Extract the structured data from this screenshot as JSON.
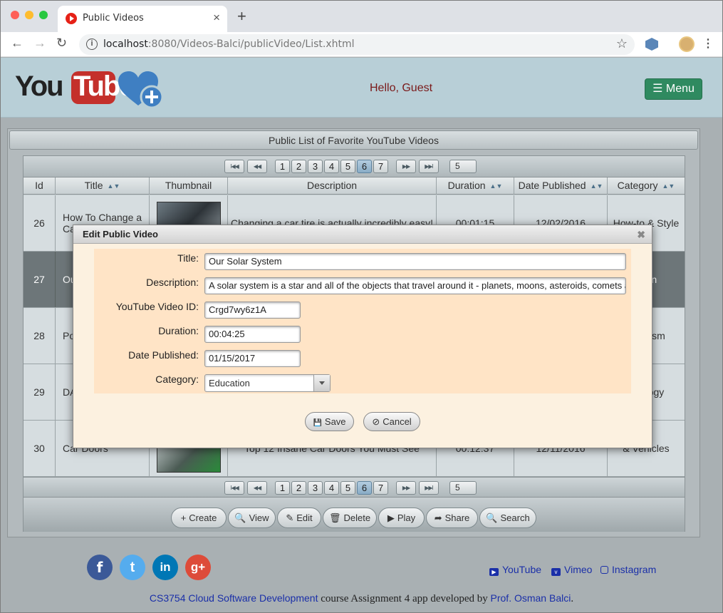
{
  "browser": {
    "tab_title": "Public Videos",
    "tab_close": "×",
    "new_tab": "+",
    "url_host": "localhost",
    "url_rest": ":8080/Videos-Balci/publicVideo/List.xhtml",
    "back": "←",
    "forward": "→",
    "reload": "↻",
    "bookmark": "☆",
    "kebab": "⋮"
  },
  "header": {
    "logo_you": "You",
    "logo_tube": "Tube",
    "greeting": "Hello, Guest",
    "menu_label": "☰ Menu"
  },
  "panel": {
    "title": "Public List of Favorite YouTube Videos",
    "pager": {
      "first": "I◀◀",
      "prev": "◀◀",
      "pages": [
        "1",
        "2",
        "3",
        "4",
        "5",
        "6",
        "7"
      ],
      "active_page": "6",
      "next": "▶▶",
      "last": "▶▶I",
      "rows_per_page": "5"
    },
    "columns": [
      "Id",
      "Title",
      "Thumbnail",
      "Description",
      "Duration",
      "Date Published",
      "Category"
    ],
    "sort_icon": "▲▼",
    "rows": [
      {
        "id": "26",
        "title": "How To Change a Ca",
        "description": "Changing a car tire is actually incredibly easy!",
        "duration": "00:01:15",
        "date": "12/02/2016",
        "category": "How-to & Style"
      },
      {
        "id": "27",
        "title": "Ou",
        "description": "",
        "duration": "",
        "date": "",
        "category": "ation"
      },
      {
        "id": "28",
        "title": "Po Ur Re",
        "description": "",
        "duration": "",
        "date": "",
        "category": "fits & sm"
      },
      {
        "id": "29",
        "title": "DA Te",
        "description": "",
        "duration": "",
        "date": "",
        "category": "e & logy"
      },
      {
        "id": "30",
        "title": "Car Doors",
        "description": "Top 12 Insane Car Doors You Must See",
        "duration": "00:12:37",
        "date": "12/11/2016",
        "category": "& Vehicles"
      }
    ],
    "actions": [
      {
        "icon": "+",
        "label": "Create"
      },
      {
        "icon": "🔍",
        "label": "View"
      },
      {
        "icon": "✎",
        "label": "Edit"
      },
      {
        "icon": "🗑",
        "label": "Delete"
      },
      {
        "icon": "▶",
        "label": "Play"
      },
      {
        "icon": "➦",
        "label": "Share"
      },
      {
        "icon": "🔍",
        "label": "Search"
      }
    ]
  },
  "dialog": {
    "title": "Edit Public Video",
    "close": "✖",
    "fields": {
      "title_label": "Title:",
      "title_value": "Our Solar System",
      "description_label": "Description:",
      "description_value": "A solar system is a star and all of the objects that travel around it - planets, moons, asteroids, comets and met",
      "video_id_label": "YouTube Video ID:",
      "video_id_value": "Crgd7wy6z1A",
      "duration_label": "Duration:",
      "duration_value": "00:04:25",
      "date_label": "Date Published:",
      "date_value": "01/15/2017",
      "category_label": "Category:",
      "category_value": "Education"
    },
    "save_label": "Save",
    "save_icon": "💾",
    "cancel_label": "Cancel",
    "cancel_icon": "⊘"
  },
  "footer": {
    "social": [
      {
        "icon": "facebook-icon",
        "glyph": "f",
        "color": "#3b5998"
      },
      {
        "icon": "twitter-icon",
        "glyph": "t",
        "color": "#55acee"
      },
      {
        "icon": "linkedin-icon",
        "glyph": "in",
        "color": "#0077b5"
      },
      {
        "icon": "googleplus-icon",
        "glyph": "g+",
        "color": "#dd4b39"
      }
    ],
    "links": [
      "YouTube",
      "Vimeo",
      "Instagram"
    ],
    "credit_link1": "CS3754 Cloud Software Development",
    "credit_mid": " course Assignment 4 app developed by ",
    "credit_link2": "Prof. Osman Balci",
    "credit_end": "."
  },
  "colors": {
    "header_bg": "#b8cfd7",
    "menu_button": "#2f8a60",
    "link": "#1a2fa8",
    "dialog_form_bg": "#ffe4c6",
    "selected_row": "#6d7679"
  }
}
